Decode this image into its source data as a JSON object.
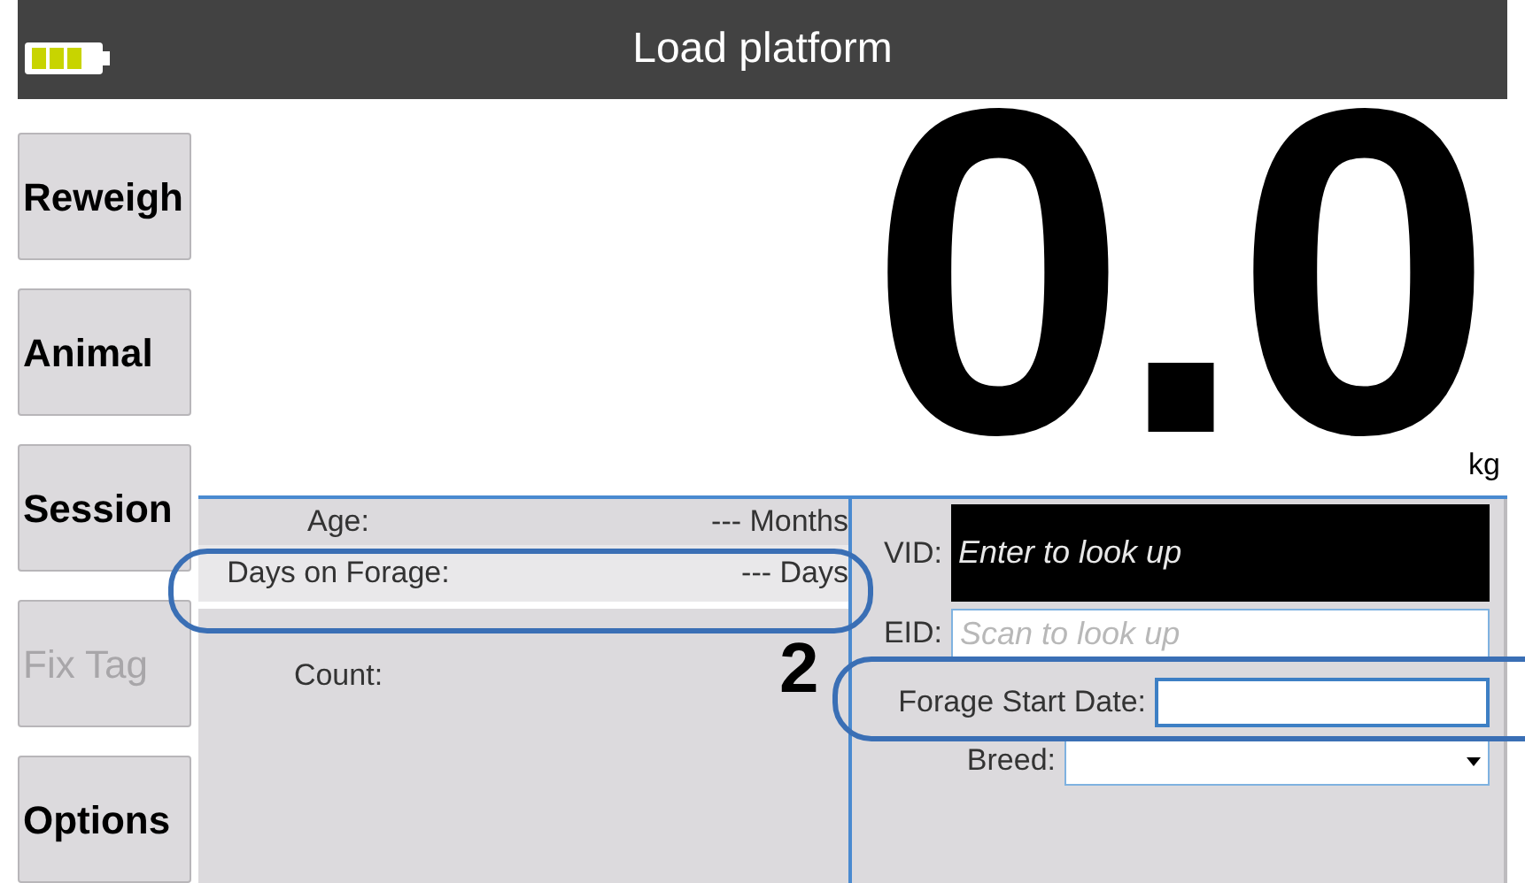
{
  "title": "Load platform",
  "buttons": [
    {
      "label": "Reweigh",
      "disabled": false
    },
    {
      "label": "Animal",
      "disabled": false
    },
    {
      "label": "Session",
      "disabled": false
    },
    {
      "label": "Fix Tag",
      "disabled": true
    },
    {
      "label": "Options",
      "disabled": false
    }
  ],
  "weight": {
    "value": "0.0",
    "unit": "kg"
  },
  "info_rows": [
    {
      "label": "Age:",
      "value": "--- Months",
      "selected": false
    },
    {
      "label": "Days on Forage:",
      "value": "--- Days",
      "selected": true
    },
    {
      "label": "Count:",
      "selected": false
    }
  ],
  "fields": [
    {
      "kind": "dark",
      "label": "VID:",
      "placeholder": "Enter to look up"
    },
    {
      "kind": "text",
      "label": "EID:",
      "placeholder": "Scan to look up"
    },
    {
      "kind": "date",
      "label": "Forage Start Date:"
    },
    {
      "kind": "select",
      "label": "Breed:"
    }
  ],
  "annotation": {
    "label": "2"
  }
}
